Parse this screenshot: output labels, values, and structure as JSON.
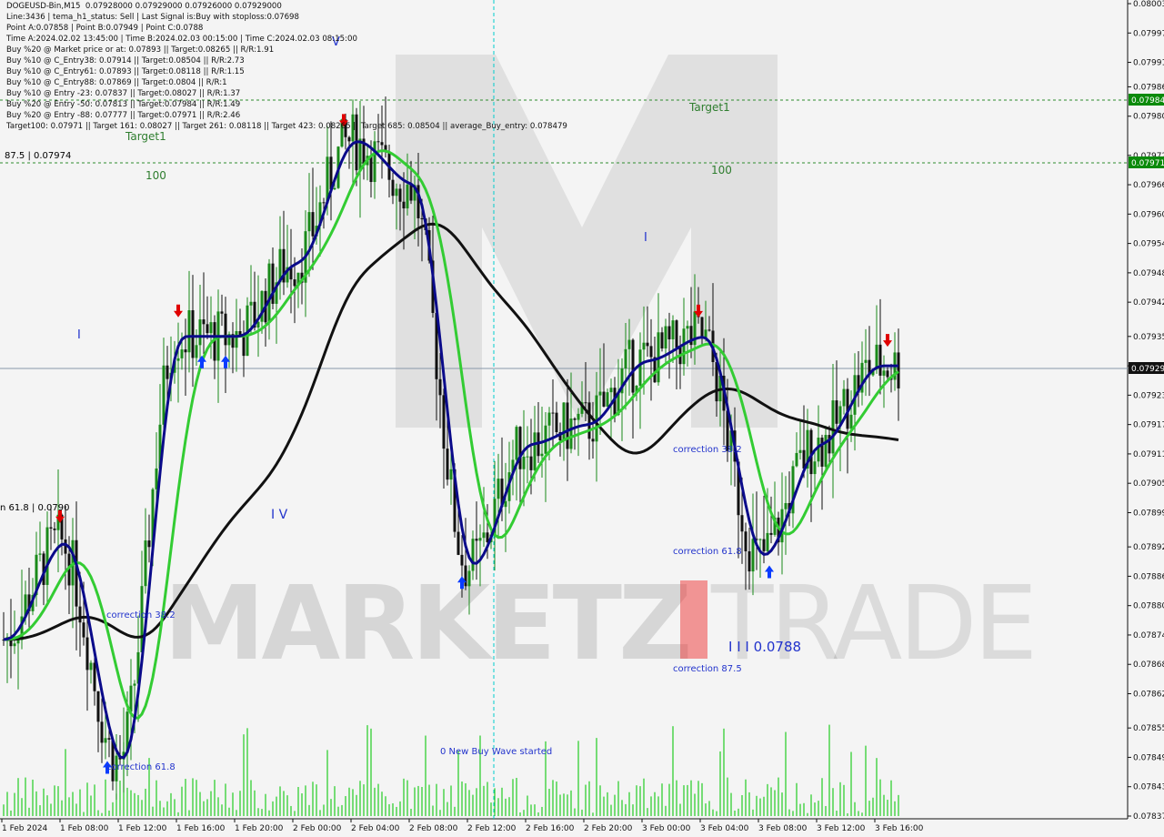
{
  "header": {
    "symbol_line": "DOGEUSD-Bin,M15  0.07928000 0.07929000 0.07926000 0.07929000",
    "line2": "Line:3436 | tema_h1_status: Sell | Last Signal is:Buy with stoploss:0.07698",
    "line3": "Point A:0.07858 | Point B:0.07949 | Point C:0.0788",
    "line4": "Time A:2024.02.02 13:45:00 | Time B:2024.02.03 00:15:00 | Time C:2024.02.03 08:15:00",
    "line5": "Buy %20 @ Market price or at: 0.07893 || Target:0.08265 || R/R:1.91",
    "line6": "Buy %10 @ C_Entry38: 0.07914 || Target:0.08504 || R/R:2.73",
    "line7": "Buy %10 @ C_Entry61: 0.07893 || Target:0.08118 || R/R:1.15",
    "line8": "Buy %10 @ C_Entry88: 0.07869 || Target:0.0804 || R/R:1",
    "line9": "Buy %10 @ Entry -23: 0.07837 || Target:0.08027 || R/R:1.37",
    "line10": "Buy %20 @ Entry -50: 0.07813 || Target:0.07984 || R/R:1.49",
    "line11": "Buy %20 @ Entry -88: 0.07777 || Target:0.07971 || R/R:2.46",
    "line12": "Target100: 0.07971 || Target 161: 0.08027 || Target 261: 0.08118 || Target 423: 0.08265 || Target 685: 0.08504 || average_Buy_entry: 0.078479"
  },
  "colors": {
    "background": "#f4f4f4",
    "bull": "#1a8a1a",
    "bear": "#111111",
    "tema": "#0a0a8a",
    "ma_green": "#33cc33",
    "ma_black": "#111111",
    "volume": "#22cc22",
    "buy_arrow": "#0a3cff",
    "sell_arrow": "#e00000",
    "target_line": "#2e8b2e",
    "price_box": "#111111",
    "target_box": "#0a8a0a"
  },
  "chart_data": {
    "type": "line",
    "title": "DOGEUSD-Bin,M15",
    "ylim": [
      0.07837,
      0.08003
    ],
    "y_ticks": [
      "0.08003",
      "0.07997",
      "0.07991",
      "0.07986",
      "0.07980",
      "0.07972",
      "0.07966",
      "0.07960",
      "0.07954",
      "0.07948",
      "0.07942",
      "0.07935",
      "0.07929",
      "0.07923",
      "0.07917",
      "0.07911",
      "0.07905",
      "0.07899",
      "0.07892",
      "0.07886",
      "0.07880",
      "0.07874",
      "0.07868",
      "0.07862",
      "0.07855",
      "0.07849",
      "0.07843",
      "0.07837"
    ],
    "x_ticks": [
      "1 Feb 2024",
      "1 Feb 08:00",
      "1 Feb 12:00",
      "1 Feb 16:00",
      "1 Feb 20:00",
      "2 Feb 00:00",
      "2 Feb 04:00",
      "2 Feb 08:00",
      "2 Feb 12:00",
      "2 Feb 16:00",
      "2 Feb 20:00",
      "3 Feb 00:00",
      "3 Feb 04:00",
      "3 Feb 08:00",
      "3 Feb 12:00",
      "3 Feb 16:00"
    ],
    "current_price": "0.07929",
    "target1_price": "0.07984",
    "target100_price": "0.07971",
    "close_series": [
      {
        "x": "1 Feb 2024",
        "y": 0.07873
      },
      {
        "x": "1 Feb 08:00",
        "y": 0.07893
      },
      {
        "x": "1 Feb 12:00",
        "y": 0.07848
      },
      {
        "x": "1 Feb 16:00",
        "y": 0.07935
      },
      {
        "x": "1 Feb 20:00",
        "y": 0.07935
      },
      {
        "x": "2 Feb 00:00",
        "y": 0.0795
      },
      {
        "x": "2 Feb 04:00",
        "y": 0.07975
      },
      {
        "x": "2 Feb 08:00",
        "y": 0.07966
      },
      {
        "x": "2 Feb 12:00",
        "y": 0.07888
      },
      {
        "x": "2 Feb 16:00",
        "y": 0.07913
      },
      {
        "x": "2 Feb 20:00",
        "y": 0.07917
      },
      {
        "x": "3 Feb 00:00",
        "y": 0.0793
      },
      {
        "x": "3 Feb 04:00",
        "y": 0.07935
      },
      {
        "x": "3 Feb 08:00",
        "y": 0.0789
      },
      {
        "x": "3 Feb 12:00",
        "y": 0.07913
      },
      {
        "x": "3 Feb 16:00",
        "y": 0.07929
      }
    ],
    "annotations": {
      "target1_right": "Target1",
      "target1_left": "Target1",
      "hundred_right": "100",
      "hundred_left": "100",
      "fib_left": "87.5 | 0.07974",
      "corr382_left": "correction 38.2",
      "corr618_left": "correction 61.8",
      "corr382_right": "correction 38.2",
      "corr618_right": "correction 61.8",
      "corr875_right": "correction 87.5",
      "new_wave": "0 New Buy Wave started",
      "wave_label": "I I I 0.0788",
      "wave_iv": "I V",
      "wave_v": "V",
      "wave_i": "I",
      "wave_i2": "I",
      "entry_left": "n 61.8 | 0.0790"
    },
    "watermark": "MARKETZITRADE"
  }
}
